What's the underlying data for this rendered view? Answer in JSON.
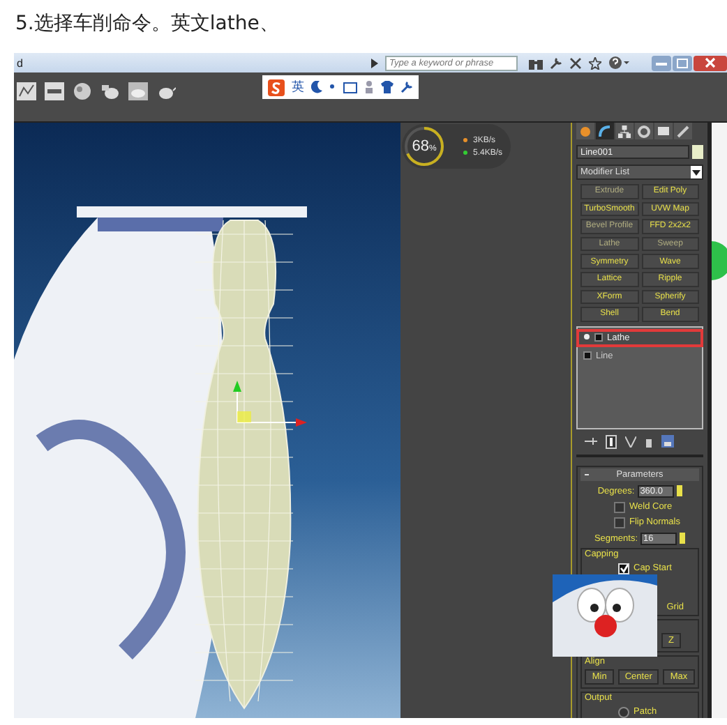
{
  "caption": "5.选择车削命令。英文lathe、",
  "window": {
    "title": "d",
    "search": {
      "placeholder": "Type a keyword or phrase"
    }
  },
  "ime_bar": {
    "mode": "英"
  },
  "net_meter": {
    "percent": "68",
    "unit": "%",
    "level": 0.68,
    "upload": "3KB/s",
    "download": "5.4KB/s"
  },
  "command_panel": {
    "tabs": [
      {
        "kind": "create",
        "selected": false
      },
      {
        "kind": "modify",
        "selected": true
      },
      {
        "kind": "hierarchy",
        "selected": false
      },
      {
        "kind": "motion",
        "selected": false
      },
      {
        "kind": "display",
        "selected": false
      },
      {
        "kind": "utilities",
        "selected": false
      }
    ],
    "object_name": "Line001",
    "modifier_list": "Modifier List",
    "modifier_buttons": [
      {
        "label": "Extrude",
        "dim": true
      },
      {
        "label": "Edit Poly",
        "dim": false
      },
      {
        "label": "TurboSmooth",
        "dim": false
      },
      {
        "label": "UVW Map",
        "dim": false
      },
      {
        "label": "Bevel Profile",
        "dim": true
      },
      {
        "label": "FFD 2x2x2",
        "dim": false
      },
      {
        "label": "Lathe",
        "dim": true
      },
      {
        "label": "Sweep",
        "dim": true
      },
      {
        "label": "Symmetry",
        "dim": false
      },
      {
        "label": "Wave",
        "dim": false
      },
      {
        "label": "Lattice",
        "dim": false
      },
      {
        "label": "Ripple",
        "dim": false
      },
      {
        "label": "XForm",
        "dim": false
      },
      {
        "label": "Spherify",
        "dim": false
      },
      {
        "label": "Shell",
        "dim": false
      },
      {
        "label": "Bend",
        "dim": false
      }
    ],
    "stack": [
      {
        "label": "Lathe",
        "selected": true
      },
      {
        "label": "Line",
        "selected": false
      }
    ]
  },
  "parameters": {
    "title": "Parameters",
    "degrees": {
      "label": "Degrees:",
      "value": "360.0"
    },
    "options": [
      {
        "label": "Weld Core",
        "checked": false
      },
      {
        "label": "Flip Normals",
        "checked": false
      }
    ],
    "segments": {
      "label": "Segments:",
      "value": "16"
    },
    "capping": {
      "title": "Capping",
      "options": [
        {
          "label": "Cap Start",
          "checked": true
        }
      ],
      "grid": "Grid"
    },
    "direction": {
      "buttons": [
        "Z"
      ]
    },
    "align": {
      "title": "Align",
      "buttons": [
        "Min",
        "Center",
        "Max"
      ]
    },
    "output": {
      "title": "Output",
      "options": [
        {
          "label": "Patch",
          "selected": false
        }
      ]
    }
  }
}
